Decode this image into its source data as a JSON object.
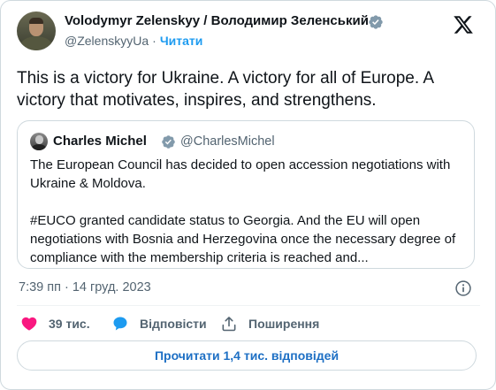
{
  "author": {
    "name": "Volodymyr Zelenskyy / Володимир Зеленський",
    "handle": "@ZelenskyyUa",
    "separator": "·",
    "follow_label": "Читати"
  },
  "tweet": {
    "text": "This is a victory for Ukraine. A victory for all of Europe. A victory that motivates, inspires, and strengthens."
  },
  "quote": {
    "name": "Charles Michel",
    "handle": "@CharlesMichel",
    "text": "The European Council has decided to open accession negotiations with Ukraine & Moldova.\n\n#EUCO granted candidate status to Georgia. And the EU will open negotiations with Bosnia and Herzegovina once the necessary degree of compliance with the membership criteria  is reached and..."
  },
  "meta": {
    "timestamp": "7:39 пп · 14 груд. 2023"
  },
  "actions": {
    "like_count": "39 тис.",
    "reply_label": "Відповісти",
    "share_label": "Поширення"
  },
  "read_replies_label": "Прочитати 1,4 тис. відповідей",
  "icons": {
    "verified": "verified-badge-icon",
    "x_logo": "x-logo-icon",
    "info": "info-icon",
    "like": "heart-icon",
    "reply": "reply-bubble-icon",
    "share": "share-upload-icon"
  },
  "colors": {
    "accent": "#1d9bf0",
    "like": "#f91880",
    "muted": "#536471",
    "border": "#cfd9de"
  }
}
